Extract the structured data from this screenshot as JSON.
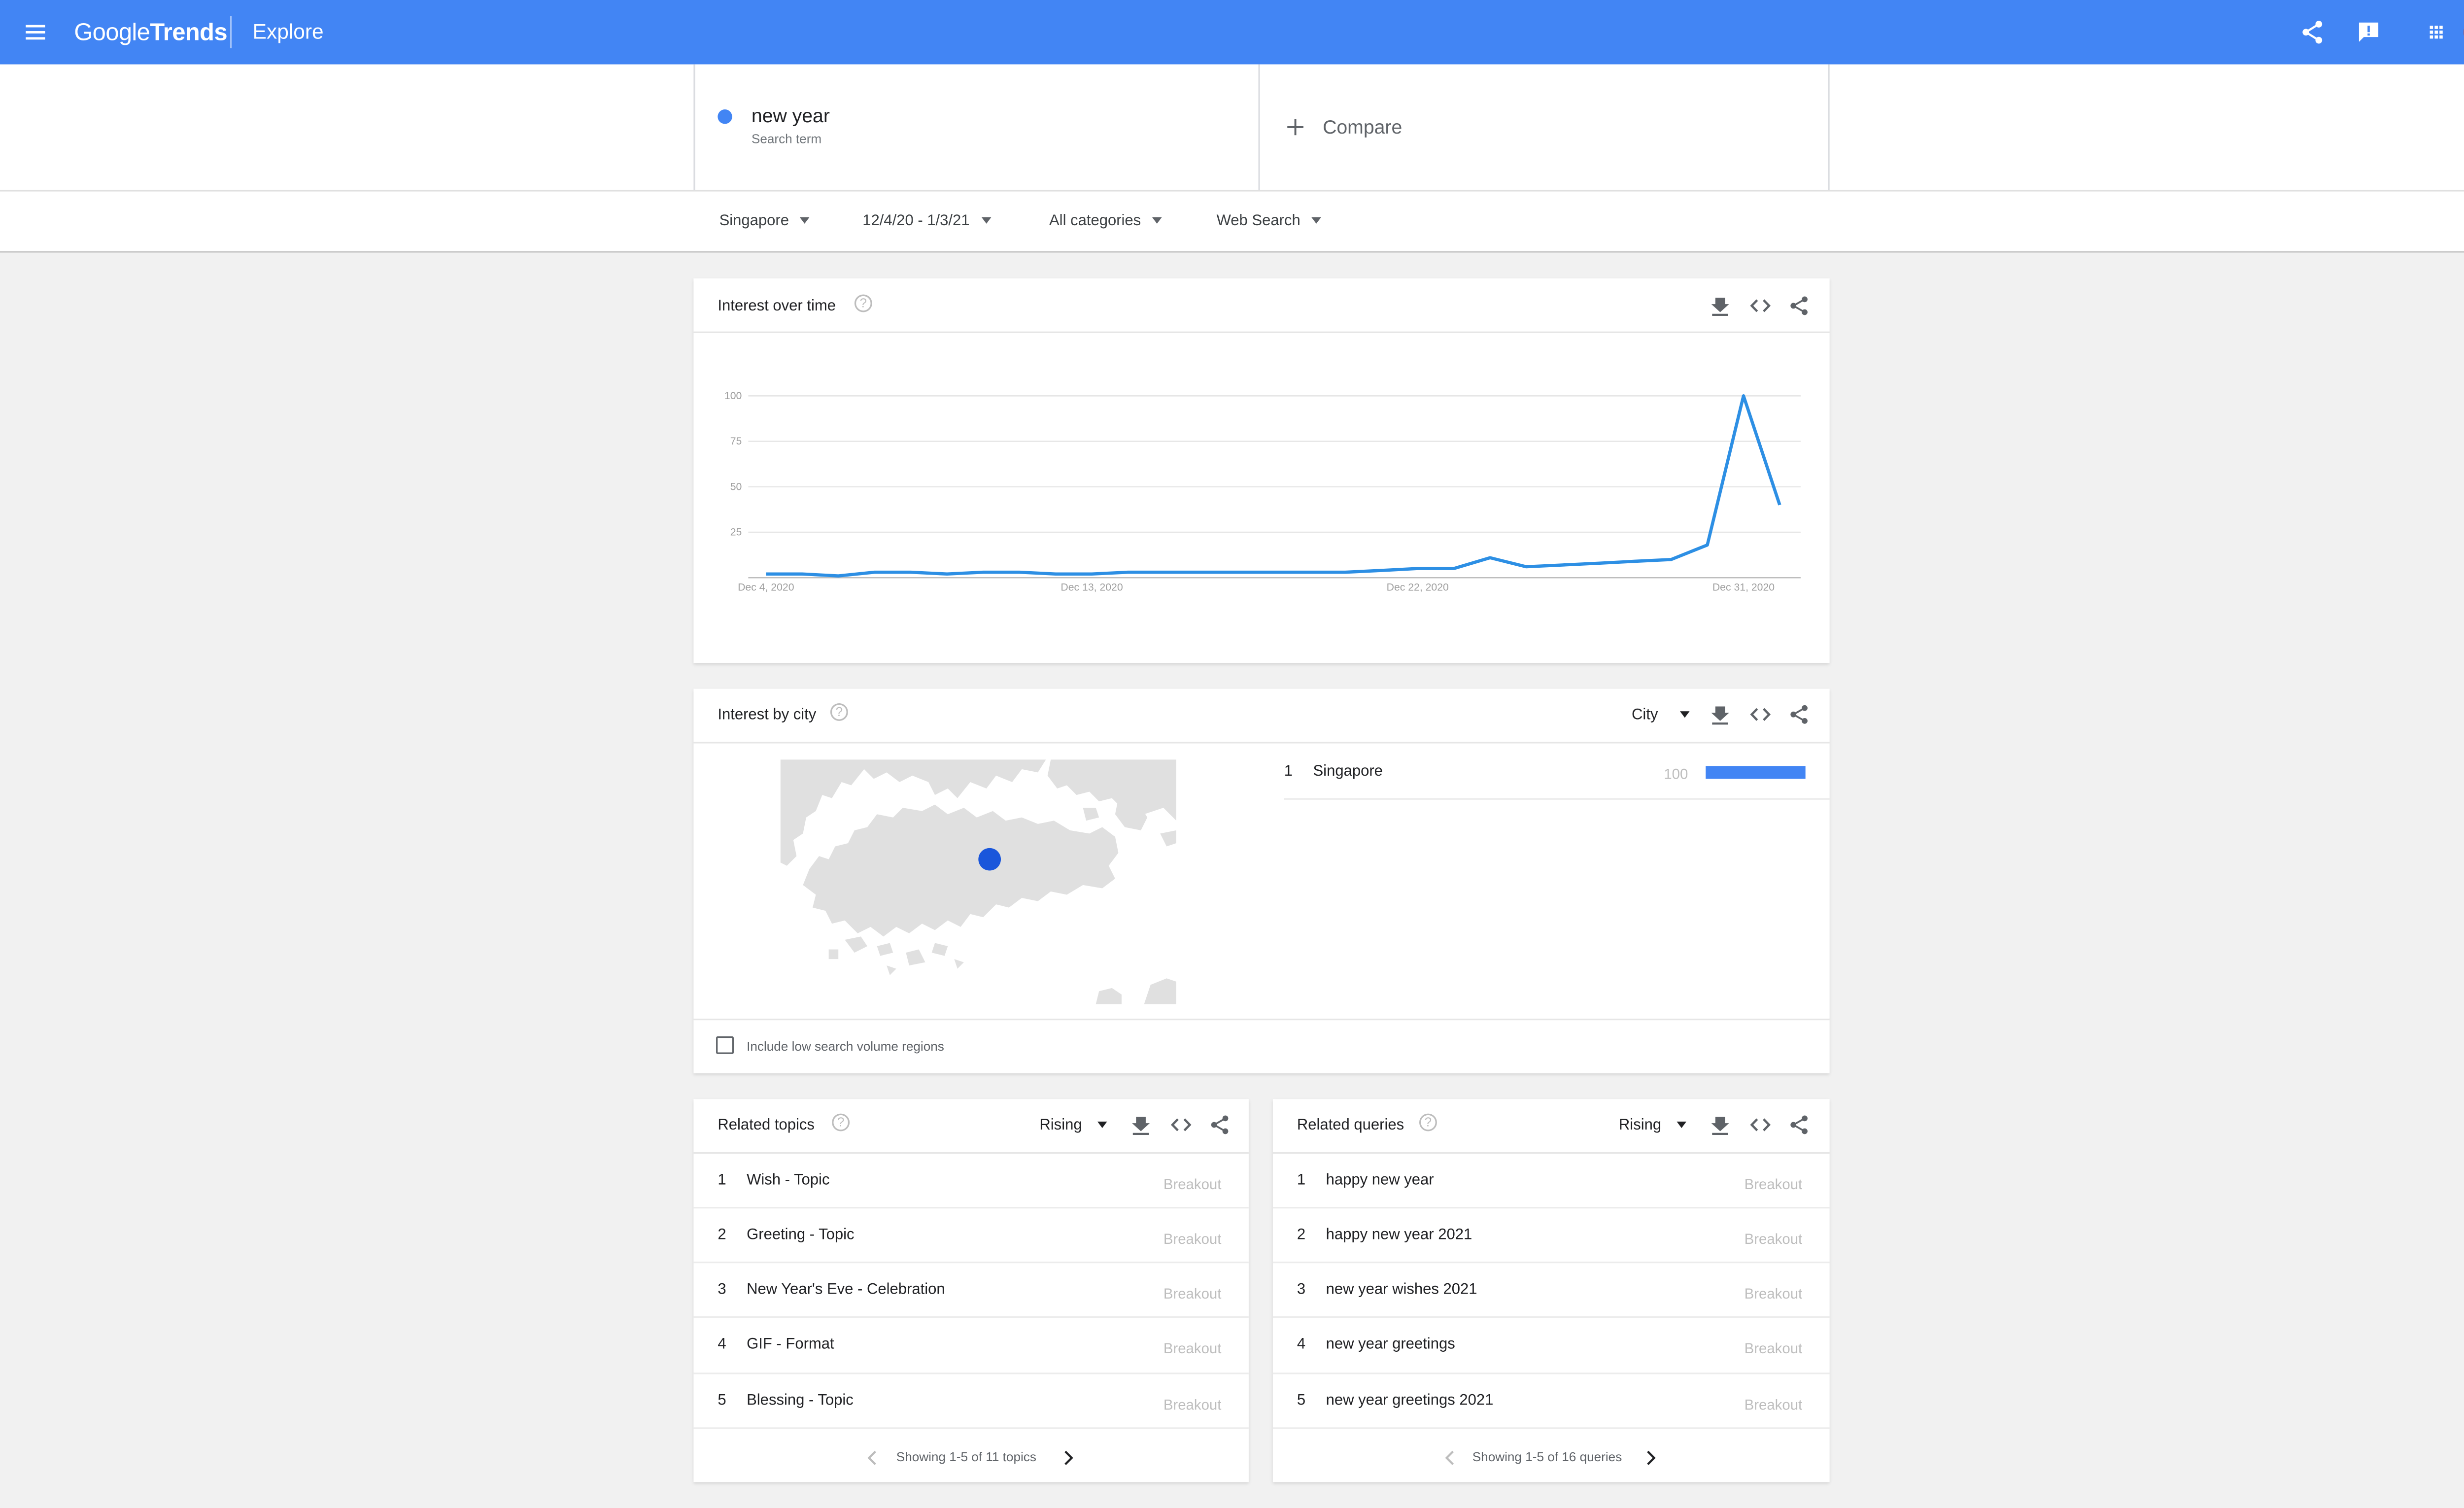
{
  "topbar": {
    "logo_google": "Google",
    "logo_trends": "Trends",
    "section": "Explore",
    "menu_icon": "hamburger-menu-icon",
    "share_icon": "share-icon",
    "feedback_icon": "feedback-icon",
    "apps_icon": "apps-grid-icon",
    "brand_color": "#4285f4"
  },
  "search": {
    "term": "new year",
    "term_sub": "Search term",
    "term_color": "#4285f4",
    "compare_label": "Compare"
  },
  "filters": {
    "region": "Singapore",
    "date_range": "12/4/20 - 1/3/21",
    "category": "All categories",
    "property": "Web Search"
  },
  "interest_over_time": {
    "title": "Interest over time",
    "chart_data": {
      "type": "line",
      "ylim": [
        0,
        100
      ],
      "y_ticks": [
        "100",
        "75",
        "50",
        "25"
      ],
      "x_ticks": [
        "Dec 4, 2020",
        "Dec 13, 2020",
        "Dec 22, 2020",
        "Dec 31, 2020"
      ],
      "x": [
        "2020-12-04",
        "2020-12-05",
        "2020-12-06",
        "2020-12-07",
        "2020-12-08",
        "2020-12-09",
        "2020-12-10",
        "2020-12-11",
        "2020-12-12",
        "2020-12-13",
        "2020-12-14",
        "2020-12-15",
        "2020-12-16",
        "2020-12-17",
        "2020-12-18",
        "2020-12-19",
        "2020-12-20",
        "2020-12-21",
        "2020-12-22",
        "2020-12-23",
        "2020-12-24",
        "2020-12-25",
        "2020-12-26",
        "2020-12-27",
        "2020-12-28",
        "2020-12-29",
        "2020-12-30",
        "2020-12-31",
        "2021-01-01"
      ],
      "series": [
        {
          "values": [
            2,
            2,
            1,
            3,
            3,
            2,
            3,
            3,
            2,
            2,
            3,
            3,
            3,
            3,
            3,
            3,
            3,
            4,
            5,
            5,
            11,
            6,
            7,
            8,
            9,
            10,
            18,
            100,
            40
          ],
          "color": "#2d8fe4"
        }
      ]
    }
  },
  "interest_by_city": {
    "title": "Interest by city",
    "dropdown": "City",
    "rows": [
      {
        "rank": "1",
        "name": "Singapore",
        "value": "100",
        "share": 1.0
      }
    ],
    "checkbox_label": "Include low search volume regions",
    "bar_color": "#4285f4",
    "map_dot_color": "#1a56db"
  },
  "related_topics": {
    "title": "Related topics",
    "dropdown": "Rising",
    "rows": [
      {
        "rank": "1",
        "text": "Wish - Topic",
        "value": "Breakout"
      },
      {
        "rank": "2",
        "text": "Greeting - Topic",
        "value": "Breakout"
      },
      {
        "rank": "3",
        "text": "New Year's Eve - Celebration",
        "value": "Breakout"
      },
      {
        "rank": "4",
        "text": "GIF - Format",
        "value": "Breakout"
      },
      {
        "rank": "5",
        "text": "Blessing - Topic",
        "value": "Breakout"
      }
    ],
    "pager": "Showing 1-5 of 11 topics"
  },
  "related_queries": {
    "title": "Related queries",
    "dropdown": "Rising",
    "rows": [
      {
        "rank": "1",
        "text": "happy new year",
        "value": "Breakout"
      },
      {
        "rank": "2",
        "text": "happy new year 2021",
        "value": "Breakout"
      },
      {
        "rank": "3",
        "text": "new year wishes 2021",
        "value": "Breakout"
      },
      {
        "rank": "4",
        "text": "new year greetings",
        "value": "Breakout"
      },
      {
        "rank": "5",
        "text": "new year greetings 2021",
        "value": "Breakout"
      }
    ],
    "pager": "Showing 1-5 of 16 queries"
  }
}
